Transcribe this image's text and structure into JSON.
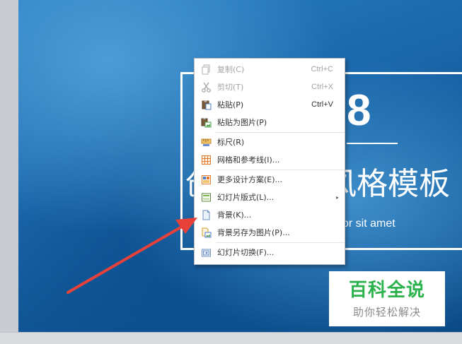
{
  "slide": {
    "number_fragment": "8",
    "title_left_fragment": "创",
    "title_right_fragment": "风格模板",
    "subtitle_fragment": "or sit amet"
  },
  "context_menu": {
    "items": [
      {
        "label": "复制(C)",
        "shortcut": "Ctrl+C",
        "enabled": false,
        "icon": "copy-icon"
      },
      {
        "label": "剪切(T)",
        "shortcut": "Ctrl+X",
        "enabled": false,
        "icon": "scissors-icon"
      },
      {
        "label": "粘贴(P)",
        "shortcut": "Ctrl+V",
        "enabled": true,
        "icon": "paste-icon"
      },
      {
        "label": "粘贴为图片(P)",
        "shortcut": "",
        "enabled": true,
        "icon": "paste-as-picture-icon"
      },
      {
        "label": "标尺(R)",
        "shortcut": "",
        "enabled": true,
        "icon": "ruler-icon"
      },
      {
        "label": "网格和参考线(I)...",
        "shortcut": "",
        "enabled": true,
        "icon": "grid-icon"
      },
      {
        "label": "更多设计方案(E)...",
        "shortcut": "",
        "enabled": true,
        "icon": "design-scheme-icon"
      },
      {
        "label": "幻灯片版式(L)...",
        "shortcut": "",
        "enabled": true,
        "icon": "slide-layout-icon",
        "has_submenu": true
      },
      {
        "label": "背景(K)...",
        "shortcut": "",
        "enabled": true,
        "icon": "background-icon"
      },
      {
        "label": "背景另存为图片(P)...",
        "shortcut": "",
        "enabled": true,
        "icon": "save-background-icon"
      },
      {
        "label": "幻灯片切换(F)...",
        "shortcut": "",
        "enabled": true,
        "icon": "slide-transition-icon"
      }
    ]
  },
  "colors": {
    "arrow": "#e8413a",
    "watermark_green": "#2bb24c"
  },
  "watermark": {
    "title": "百科全说",
    "subtitle": "助你轻松解决"
  }
}
